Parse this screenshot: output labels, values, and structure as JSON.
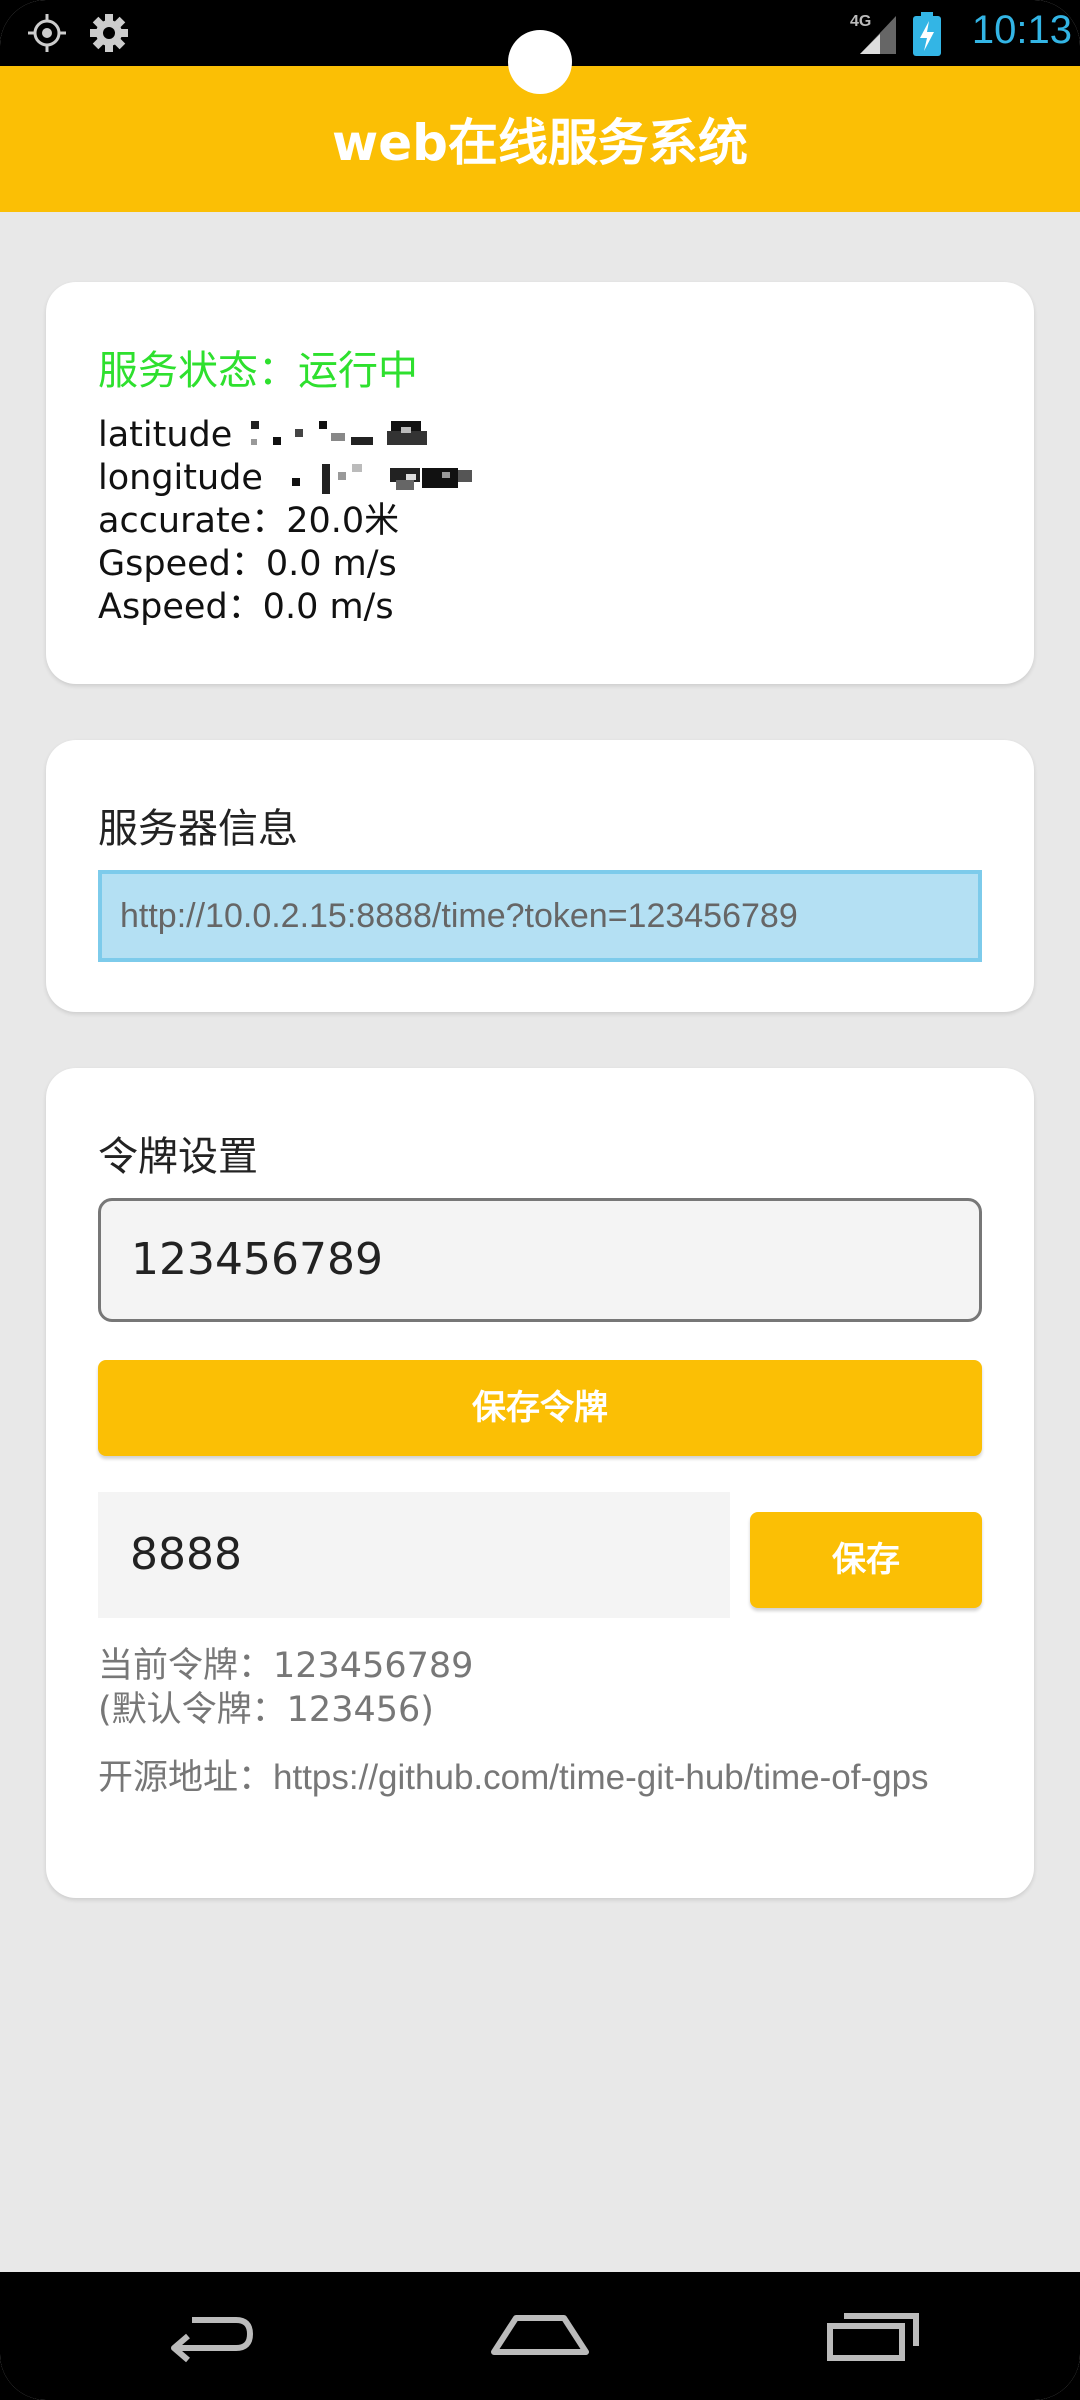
{
  "status_bar": {
    "time": "10:13",
    "network_label": "4G",
    "icons": [
      "locate-icon",
      "gear-icon",
      "signal-icon",
      "battery-charging-icon"
    ]
  },
  "app_bar": {
    "title": "web在线服务系统"
  },
  "status_card": {
    "status": "服务状态：运行中",
    "latitude_label": "latitude",
    "longitude_label": "longitude",
    "accurate": "accurate：20.0米",
    "gspeed": "Gspeed：0.0 m/s",
    "aspeed": "Aspeed：0.0 m/s"
  },
  "server_card": {
    "title": "服务器信息",
    "url": "http://10.0.2.15:8888/time?token=123456789"
  },
  "token_card": {
    "title": "令牌设置",
    "token_value": "123456789",
    "save_token_label": "保存令牌",
    "port_value": "8888",
    "save_port_label": "保存",
    "current_token": "当前令牌：123456789",
    "default_token": "(默认令牌：123456)",
    "source_url": "开源地址：https://github.com/time-git-hub/time-of-gps"
  },
  "nav_bar": {
    "icons": [
      "back-icon",
      "home-icon",
      "recent-apps-icon"
    ]
  },
  "colors": {
    "accent": "#fbbf05",
    "status_green": "#2ee02e",
    "url_bg": "#b4e0f3",
    "time_blue": "#33b5e5"
  }
}
